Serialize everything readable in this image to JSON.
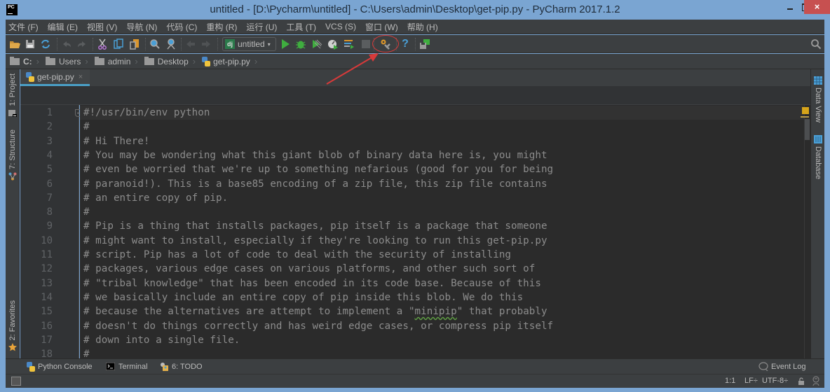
{
  "window": {
    "title": "untitled - [D:\\Pycharm\\untitled] - C:\\Users\\admin\\Desktop\\get-pip.py - PyCharm 2017.1.2",
    "logo_text": "PC",
    "close_glyph": "×"
  },
  "menubar": {
    "items": [
      {
        "label": "文件 (F)"
      },
      {
        "label": "编辑 (E)"
      },
      {
        "label": "视图 (V)"
      },
      {
        "label": "导航 (N)"
      },
      {
        "label": "代码 (C)"
      },
      {
        "label": "重构 (R)"
      },
      {
        "label": "运行 (U)"
      },
      {
        "label": "工具 (T)"
      },
      {
        "label": "VCS (S)"
      },
      {
        "label": "窗口 (W)"
      },
      {
        "label": "帮助 (H)"
      }
    ]
  },
  "toolbar": {
    "run_config": {
      "badge": "dj",
      "label": "untitled",
      "caret": "▾"
    },
    "icons": {
      "open": "open-folder-icon",
      "save": "save-all-icon",
      "sync": "synchronize-icon",
      "undo": "undo-icon",
      "redo": "redo-icon",
      "cut": "cut-icon",
      "copy": "copy-icon",
      "paste": "paste-icon",
      "find": "find-icon",
      "replace": "replace-icon",
      "back": "back-icon",
      "forward": "forward-icon",
      "run": "run-icon",
      "debug": "debug-icon",
      "coverage": "run-with-coverage-icon",
      "profile": "profile-icon",
      "concurrency": "concurrency-diagram-icon",
      "stop": "stop-icon",
      "settings": "project-settings-icon",
      "help": "help-icon",
      "sdk": "python-sdk-icon",
      "search": "search-everywhere-icon"
    },
    "help_glyph": "?"
  },
  "breadcrumbs": [
    {
      "label": "C:",
      "type": "folder"
    },
    {
      "label": "Users",
      "type": "folder"
    },
    {
      "label": "admin",
      "type": "folder"
    },
    {
      "label": "Desktop",
      "type": "folder"
    },
    {
      "label": "get-pip.py",
      "type": "python-file"
    }
  ],
  "left_tool_windows": [
    {
      "label": "1: Project"
    },
    {
      "label": "7: Structure"
    },
    {
      "label": "2: Favorites"
    }
  ],
  "right_tool_windows": [
    {
      "label": "Data View"
    },
    {
      "label": "Database"
    }
  ],
  "editor": {
    "tabs": [
      {
        "label": "get-pip.py",
        "active": true,
        "close_glyph": "×"
      }
    ],
    "lines": [
      {
        "no": "1",
        "text": "#!/usr/bin/env python"
      },
      {
        "no": "2",
        "text": "#"
      },
      {
        "no": "3",
        "text": "# Hi There!"
      },
      {
        "no": "4",
        "text": "# You may be wondering what this giant blob of binary data here is, you might"
      },
      {
        "no": "5",
        "text": "# even be worried that we're up to something nefarious (good for you for being"
      },
      {
        "no": "6",
        "text": "# paranoid!). This is a base85 encoding of a zip file, this zip file contains"
      },
      {
        "no": "7",
        "text": "# an entire copy of pip."
      },
      {
        "no": "8",
        "text": "#"
      },
      {
        "no": "9",
        "text": "# Pip is a thing that installs packages, pip itself is a package that someone"
      },
      {
        "no": "10",
        "text": "# might want to install, especially if they're looking to run this get-pip.py"
      },
      {
        "no": "11",
        "text": "# script. Pip has a lot of code to deal with the security of installing"
      },
      {
        "no": "12",
        "text": "# packages, various edge cases on various platforms, and other such sort of"
      },
      {
        "no": "13",
        "text": "# \"tribal knowledge\" that has been encoded in its code base. Because of this"
      },
      {
        "no": "14",
        "text": "# we basically include an entire copy of pip inside this blob. We do this"
      },
      {
        "no": "15",
        "text_before": "# because the alternatives are attempt to implement a \"",
        "text_squiggle": "minipip",
        "text_after": "\" that probably"
      },
      {
        "no": "16",
        "text": "# doesn't do things correctly and has weird edge cases, or compress pip itself"
      },
      {
        "no": "17",
        "text": "# down into a single file."
      },
      {
        "no": "18",
        "text": "#"
      }
    ]
  },
  "bottom_tools": [
    {
      "label": "Python Console"
    },
    {
      "label": "Terminal"
    },
    {
      "label": "6: TODO"
    }
  ],
  "event_log": {
    "label": "Event Log"
  },
  "status_bar": {
    "position": "1:1",
    "line_separator": "LF÷",
    "encoding": "UTF-8÷"
  },
  "colors": {
    "accent_tab_underline": "#4a9fc6",
    "annotation_red": "#d83a3a",
    "run_green": "#3fae3f",
    "window_frame": "#7aa5d2",
    "close_red": "#c75050"
  }
}
